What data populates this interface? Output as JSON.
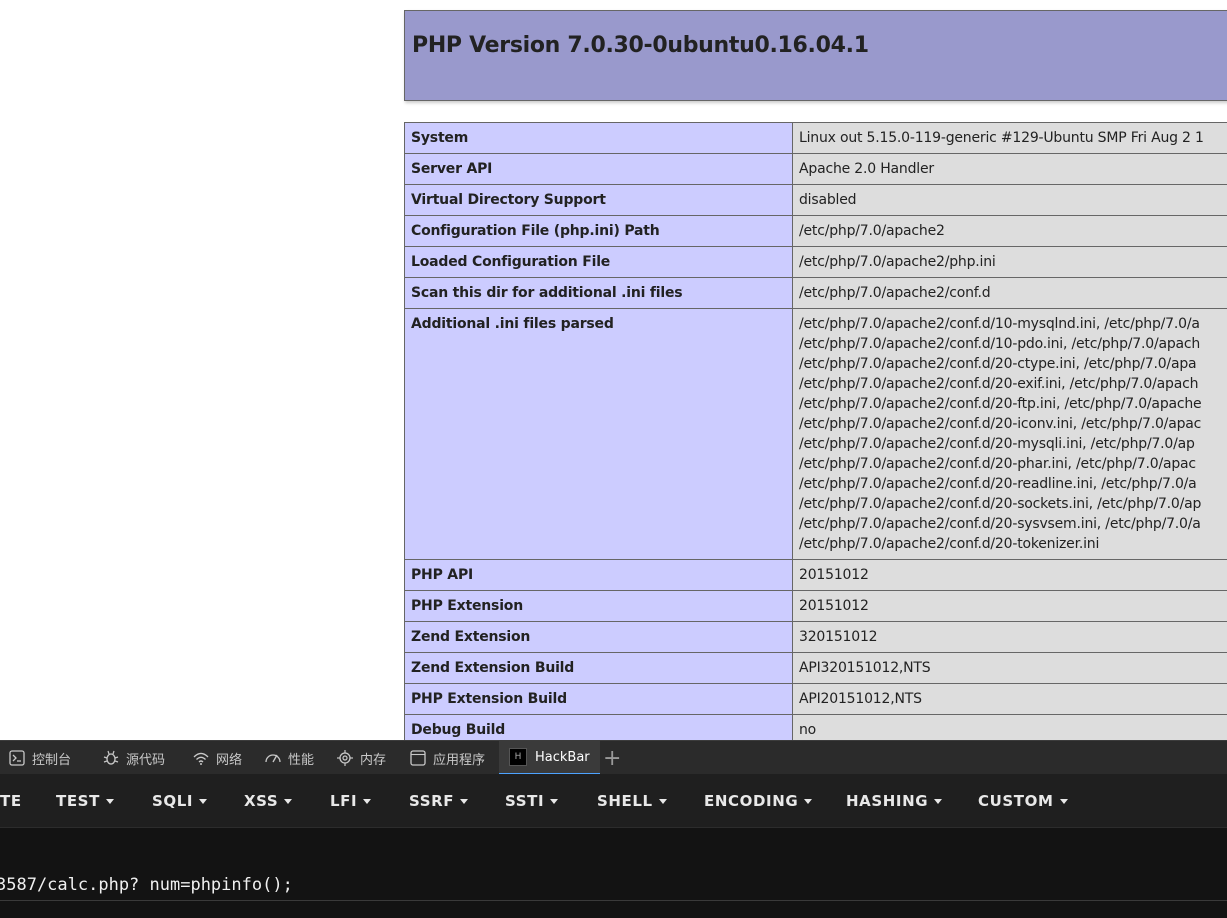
{
  "page": {
    "title": "PHP Version 7.0.30-0ubuntu0.16.04.1"
  },
  "info_rows": [
    {
      "key": "System",
      "value": [
        "Linux out 5.15.0-119-generic #129-Ubuntu SMP Fri Aug 2 1"
      ]
    },
    {
      "key": "Server API",
      "value": [
        "Apache 2.0 Handler"
      ]
    },
    {
      "key": "Virtual Directory Support",
      "value": [
        "disabled"
      ]
    },
    {
      "key": "Configuration File (php.ini) Path",
      "value": [
        "/etc/php/7.0/apache2"
      ]
    },
    {
      "key": "Loaded Configuration File",
      "value": [
        "/etc/php/7.0/apache2/php.ini"
      ]
    },
    {
      "key": "Scan this dir for additional .ini files",
      "value": [
        "/etc/php/7.0/apache2/conf.d"
      ]
    },
    {
      "key": "Additional .ini files parsed",
      "value": [
        "/etc/php/7.0/apache2/conf.d/10-mysqlnd.ini, /etc/php/7.0/a",
        "/etc/php/7.0/apache2/conf.d/10-pdo.ini, /etc/php/7.0/apach",
        "/etc/php/7.0/apache2/conf.d/20-ctype.ini, /etc/php/7.0/apa",
        "/etc/php/7.0/apache2/conf.d/20-exif.ini, /etc/php/7.0/apach",
        "/etc/php/7.0/apache2/conf.d/20-ftp.ini, /etc/php/7.0/apache",
        "/etc/php/7.0/apache2/conf.d/20-iconv.ini, /etc/php/7.0/apac",
        "/etc/php/7.0/apache2/conf.d/20-mysqli.ini, /etc/php/7.0/ap",
        "/etc/php/7.0/apache2/conf.d/20-phar.ini, /etc/php/7.0/apac",
        "/etc/php/7.0/apache2/conf.d/20-readline.ini, /etc/php/7.0/a",
        "/etc/php/7.0/apache2/conf.d/20-sockets.ini, /etc/php/7.0/ap",
        "/etc/php/7.0/apache2/conf.d/20-sysvsem.ini, /etc/php/7.0/a",
        "/etc/php/7.0/apache2/conf.d/20-tokenizer.ini"
      ]
    },
    {
      "key": "PHP API",
      "value": [
        "20151012"
      ]
    },
    {
      "key": "PHP Extension",
      "value": [
        "20151012"
      ]
    },
    {
      "key": "Zend Extension",
      "value": [
        "320151012"
      ]
    },
    {
      "key": "Zend Extension Build",
      "value": [
        "API320151012,NTS"
      ]
    },
    {
      "key": "PHP Extension Build",
      "value": [
        "API20151012,NTS"
      ]
    },
    {
      "key": "Debug Build",
      "value": [
        "no"
      ]
    }
  ],
  "devtools": {
    "tabs": [
      {
        "label": "控制台",
        "icon": "console-icon"
      },
      {
        "label": "源代码",
        "icon": "bug-icon"
      },
      {
        "label": "网络",
        "icon": "wifi-icon"
      },
      {
        "label": "性能",
        "icon": "gauge-icon"
      },
      {
        "label": "内存",
        "icon": "chip-icon"
      },
      {
        "label": "应用程序",
        "icon": "app-icon"
      },
      {
        "label": "HackBar",
        "icon": "hackbar-logo-icon",
        "active": true
      }
    ],
    "add_tab_label": "+",
    "hackbar_logo_letter": "H"
  },
  "hackbar": {
    "menus": [
      "TE",
      "TEST",
      "SQLI",
      "XSS",
      "LFI",
      "SSRF",
      "SSTI",
      "SHELL",
      "ENCODING",
      "HASHING",
      "CUSTOM"
    ],
    "url_value": "3587/calc.php? num=phpinfo();"
  },
  "colors": {
    "php_header_bg": "#9999cc",
    "key_cell_bg": "#ccccff",
    "value_cell_bg": "#dddddd",
    "devtools_bg": "#1e1e1e",
    "active_tab_accent": "#4da3ff"
  }
}
